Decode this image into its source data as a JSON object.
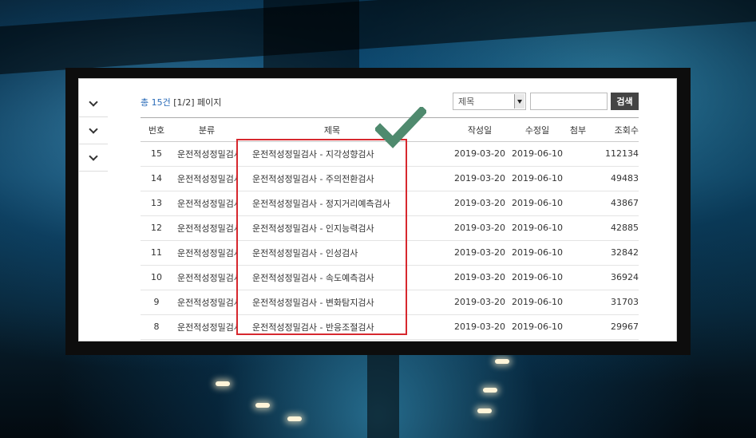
{
  "summary": {
    "total_label": "총 15건",
    "page_label": "[1/2] 페이지"
  },
  "search": {
    "field_option": "제목",
    "query": "",
    "button_label": "검색"
  },
  "columns": {
    "number": "번호",
    "category": "분류",
    "title": "제목",
    "created": "작성일",
    "modified": "수정일",
    "attachment": "첨부",
    "views": "조회수"
  },
  "rows": [
    {
      "number": "15",
      "category": "운전적성정밀검사",
      "title": "운전적성정밀검사 - 지각성향검사",
      "created": "2019-03-20",
      "modified": "2019-06-10",
      "views": "112134"
    },
    {
      "number": "14",
      "category": "운전적성정밀검사",
      "title": "운전적성정밀검사 - 주의전환검사",
      "created": "2019-03-20",
      "modified": "2019-06-10",
      "views": "49483"
    },
    {
      "number": "13",
      "category": "운전적성정밀검사",
      "title": "운전적성정밀검사 - 정지거리예측검사",
      "created": "2019-03-20",
      "modified": "2019-06-10",
      "views": "43867"
    },
    {
      "number": "12",
      "category": "운전적성정밀검사",
      "title": "운전적성정밀검사 - 인지능력검사",
      "created": "2019-03-20",
      "modified": "2019-06-10",
      "views": "42885"
    },
    {
      "number": "11",
      "category": "운전적성정밀검사",
      "title": "운전적성정밀검사 - 인성검사",
      "created": "2019-03-20",
      "modified": "2019-06-10",
      "views": "32842"
    },
    {
      "number": "10",
      "category": "운전적성정밀검사",
      "title": "운전적성정밀검사 - 속도예측검사",
      "created": "2019-03-20",
      "modified": "2019-06-10",
      "views": "36924"
    },
    {
      "number": "9",
      "category": "운전적성정밀검사",
      "title": "운전적성정밀검사 - 변화탐지검사",
      "created": "2019-03-20",
      "modified": "2019-06-10",
      "views": "31703"
    },
    {
      "number": "8",
      "category": "운전적성정밀검사",
      "title": "운전적성정밀검사 - 반응조절검사",
      "created": "2019-03-20",
      "modified": "2019-06-10",
      "views": "29967"
    }
  ],
  "annotation": {
    "box_color": "#d7282e",
    "check_color": "#4f8a6e"
  },
  "icons": {
    "sidebar_toggle": "chevron-down-icon",
    "checkmark": "checkmark-icon"
  }
}
